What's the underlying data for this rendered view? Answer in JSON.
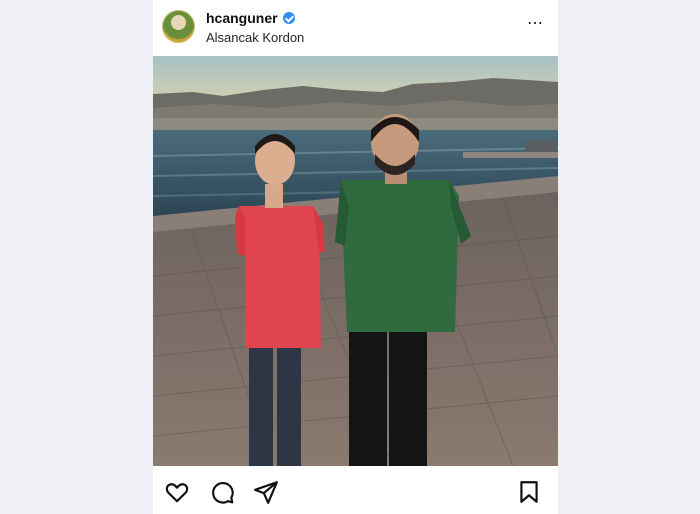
{
  "post": {
    "username": "hcanguner",
    "verified": true,
    "location": "Alsancak Kordon",
    "more_icon": "⋯"
  },
  "photo": {
    "description_icon": "photo-content"
  },
  "actions": {
    "icons": [
      "heart-icon",
      "comment-icon",
      "share-icon",
      "bookmark-icon"
    ]
  }
}
